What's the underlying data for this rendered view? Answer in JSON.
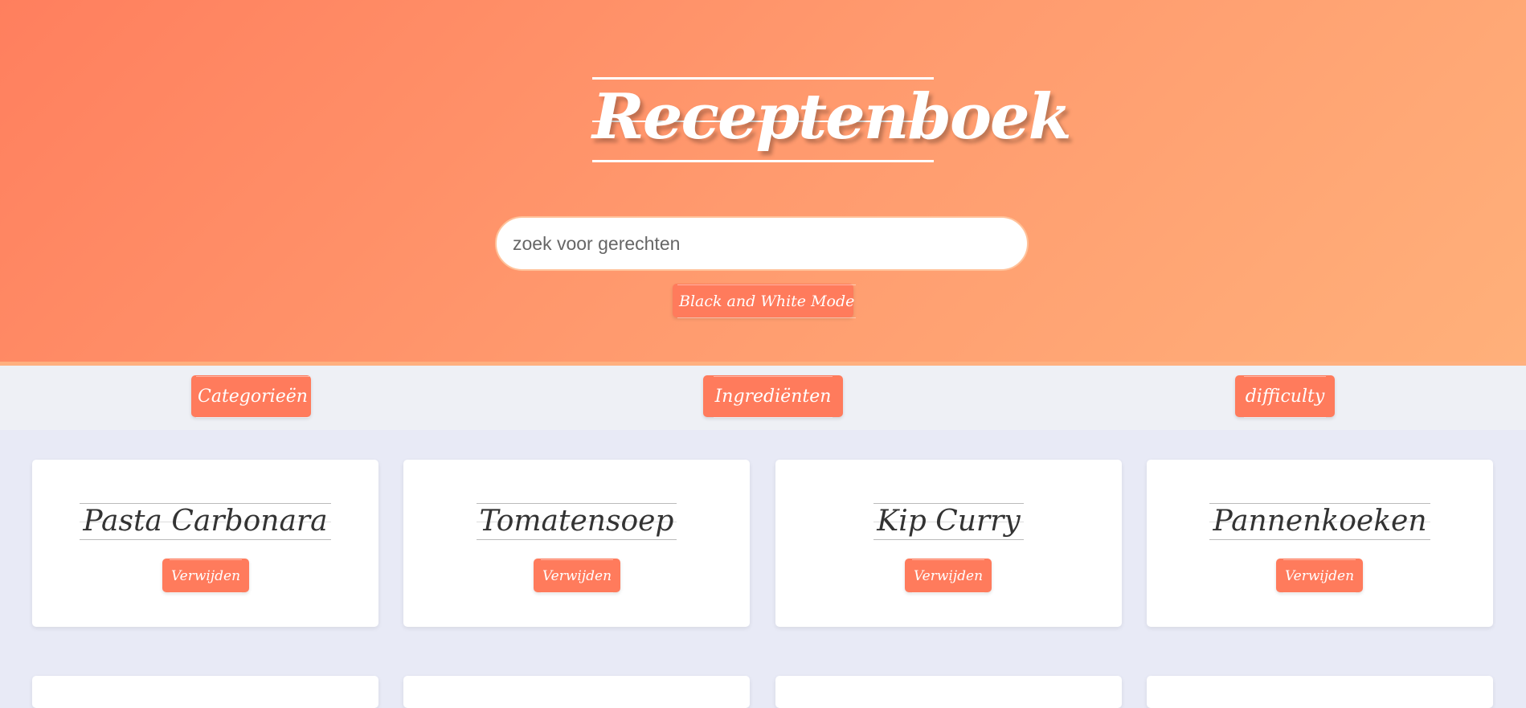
{
  "header": {
    "title": "Receptenboek",
    "search": {
      "placeholder": "zoek voor gerechten",
      "value": ""
    },
    "theme_toggle_label": "Black and White Mode"
  },
  "filters": {
    "categories_label": "Categorieën",
    "ingredients_label": "Ingrediënten",
    "difficulty_label": "difficulty"
  },
  "recipes": [
    {
      "title": "Pasta Carbonara",
      "delete_label": "Verwijden"
    },
    {
      "title": "Tomatensoep",
      "delete_label": "Verwijden"
    },
    {
      "title": "Kip Curry",
      "delete_label": "Verwijden"
    },
    {
      "title": "Pannenkoeken",
      "delete_label": "Verwijden"
    }
  ],
  "colors": {
    "accent": "#ff7b5c",
    "header_gradient_start": "#ff7f5e",
    "header_gradient_end": "#ffb07a",
    "page_background": "#e8eaf6"
  }
}
